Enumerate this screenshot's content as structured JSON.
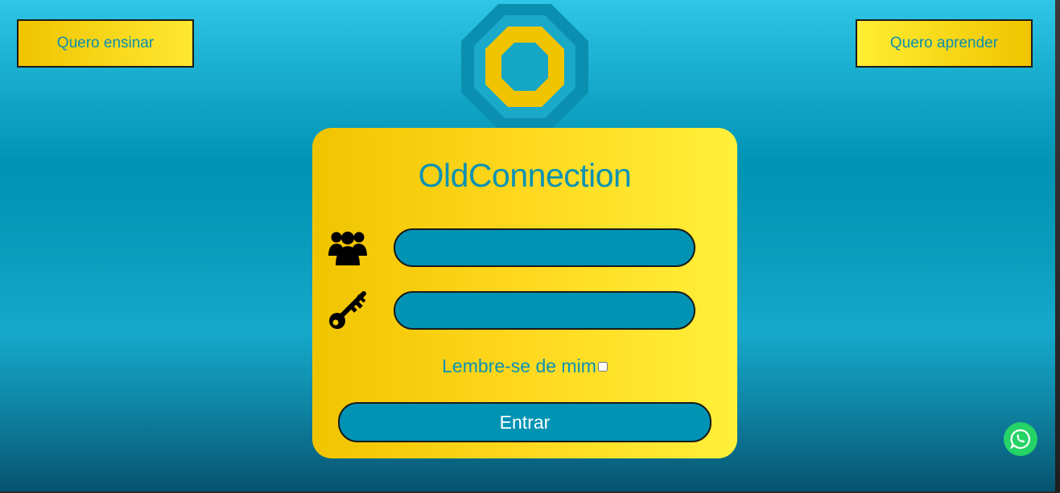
{
  "header": {
    "teach_label": "Quero ensinar",
    "learn_label": "Quero aprender"
  },
  "login": {
    "title": "OldConnection",
    "username_value": "",
    "password_value": "",
    "remember_label": "Lembre-se de mim",
    "remember_checked": false,
    "submit_label": "Entrar"
  },
  "icons": {
    "logo": "octagon-ring-logo",
    "user": "users-icon",
    "password": "key-icon",
    "chat": "whatsapp-icon"
  },
  "colors": {
    "accent_blue": "#0093b4",
    "accent_yellow": "#f0c400",
    "text_blue": "#0a92b3",
    "whatsapp_green": "#25d366"
  }
}
